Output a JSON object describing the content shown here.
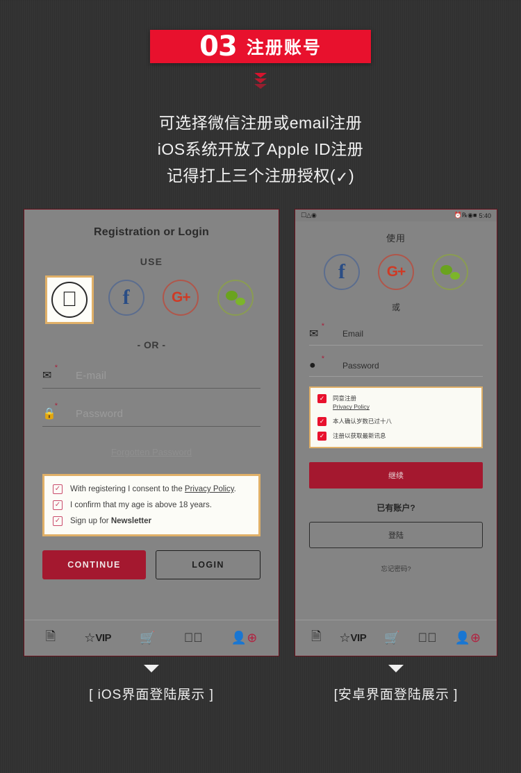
{
  "header": {
    "number": "03",
    "title": "注册账号",
    "banner_color": "#e8112d",
    "chevron_icon": "chevron-down-icon"
  },
  "description": {
    "line1": "可选择微信注册或email注册",
    "line2": "iOS系统开放了Apple ID注册",
    "line3_prefix": "记得打上三个注册授权(",
    "line3_check": "✓",
    "line3_suffix": ")"
  },
  "ios_phone": {
    "title": "Registration or Login",
    "use_label": "USE",
    "social": [
      {
        "name": "apple",
        "glyph": "",
        "highlighted": true,
        "color": "#2a2a2a"
      },
      {
        "name": "facebook",
        "glyph": "f",
        "highlighted": false,
        "color": "#5b6d8e"
      },
      {
        "name": "google",
        "glyph": "G+",
        "highlighted": false,
        "color": "#b0564a"
      },
      {
        "name": "wechat",
        "glyph": "",
        "highlighted": false,
        "color": "#8a9c52"
      }
    ],
    "or_label": "- OR -",
    "email_field": {
      "icon": "envelope-icon",
      "placeholder": "E-mail",
      "required": "*"
    },
    "password_field": {
      "icon": "lock-icon",
      "placeholder": "Password",
      "required": "*"
    },
    "forgot_link": "Forgotten Password",
    "consents": [
      {
        "pre": "With registering I consent to the ",
        "link": "Privacy Policy",
        "post": ".",
        "checked": true
      },
      {
        "pre": "I confirm that my age is above 18 years.",
        "link": "",
        "post": "",
        "checked": true
      },
      {
        "pre": "Sign up for ",
        "link": "",
        "bold": "Newsletter",
        "post": "",
        "checked": true
      }
    ],
    "continue_button": "CONTINUE",
    "login_button": "LOGIN",
    "tabbar": [
      {
        "name": "orders-icon",
        "glyph": "▤"
      },
      {
        "name": "vip-icon",
        "glyph": "VIP"
      },
      {
        "name": "cart-icon",
        "glyph": "🛒"
      },
      {
        "name": "check-circle-icon",
        "glyph": "✔"
      },
      {
        "name": "add-user-icon",
        "glyph": "&"
      }
    ]
  },
  "android_phone": {
    "status_bar": {
      "time": "5:40",
      "left_icons": "sim-signal-wifi",
      "right_icons": "alarm-bluetooth-battery"
    },
    "use_label": "使用",
    "social": [
      {
        "name": "facebook",
        "glyph": "f",
        "color": "#5b6d8e"
      },
      {
        "name": "google",
        "glyph": "G+",
        "color": "#b0564a"
      },
      {
        "name": "wechat",
        "glyph": "",
        "color": "#8a9c52"
      }
    ],
    "or_label": "或",
    "email_field": {
      "icon": "envelope-icon",
      "placeholder": "Email",
      "required": "*"
    },
    "password_field": {
      "icon": "pin-icon",
      "placeholder": "Password",
      "required": "*"
    },
    "consents": [
      {
        "line1": "同意注册",
        "link": "Privacy Policy",
        "checked": true
      },
      {
        "line1": "本人确认岁数已过十八",
        "link": "",
        "checked": true
      },
      {
        "line1": "注册以获取最新讯息",
        "link": "",
        "checked": true
      }
    ],
    "continue_button": "继续",
    "have_account": "已有账户?",
    "login_button": "登陆",
    "forgot_link": "忘记密码?",
    "tabbar": [
      {
        "name": "orders-icon",
        "glyph": "▤"
      },
      {
        "name": "vip-icon",
        "glyph": "VIP"
      },
      {
        "name": "cart-icon",
        "glyph": "🛒"
      },
      {
        "name": "check-circle-icon",
        "glyph": "✔"
      },
      {
        "name": "add-user-icon",
        "glyph": "&"
      }
    ]
  },
  "captions": {
    "ios": "[ iOS界面登陆展示 ]",
    "android": "[安卓界面登陆展示 ]",
    "arrow_icon": "triangle-down-icon"
  }
}
